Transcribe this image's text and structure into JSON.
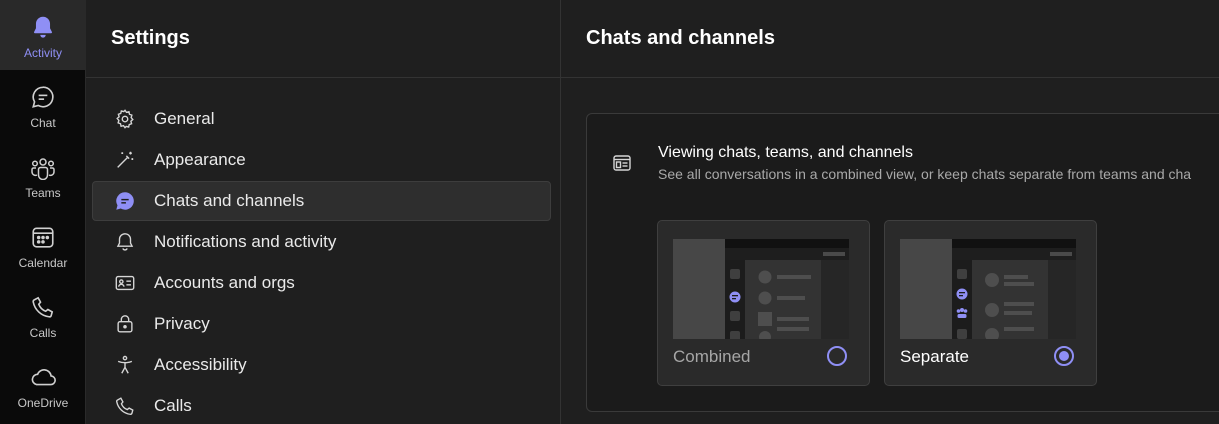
{
  "rail": {
    "items": [
      {
        "label": "Activity",
        "icon": "bell-icon",
        "active": true
      },
      {
        "label": "Chat",
        "icon": "chat-icon",
        "active": false
      },
      {
        "label": "Teams",
        "icon": "teams-icon",
        "active": false
      },
      {
        "label": "Calendar",
        "icon": "calendar-icon",
        "active": false
      },
      {
        "label": "Calls",
        "icon": "phone-icon",
        "active": false
      },
      {
        "label": "OneDrive",
        "icon": "cloud-icon",
        "active": false
      }
    ]
  },
  "settings": {
    "title": "Settings",
    "nav": [
      {
        "label": "General",
        "icon": "gear-icon"
      },
      {
        "label": "Appearance",
        "icon": "magic-wand-icon"
      },
      {
        "label": "Chats and channels",
        "icon": "chat-bubble-icon",
        "active": true
      },
      {
        "label": "Notifications and activity",
        "icon": "bell-icon"
      },
      {
        "label": "Accounts and orgs",
        "icon": "id-card-icon"
      },
      {
        "label": "Privacy",
        "icon": "lock-icon"
      },
      {
        "label": "Accessibility",
        "icon": "accessibility-icon"
      },
      {
        "label": "Calls",
        "icon": "phone-icon"
      }
    ]
  },
  "main": {
    "title": "Chats and channels",
    "section": {
      "title": "Viewing chats, teams, and channels",
      "description": "See all conversations in a combined view, or keep chats separate from teams and cha",
      "options": [
        {
          "label": "Combined",
          "selected": false
        },
        {
          "label": "Separate",
          "selected": true
        }
      ]
    }
  },
  "colors": {
    "accent": "#8f8ff5",
    "rail_bg": "#0a0a0a",
    "panel_bg": "#1f1f1f"
  }
}
